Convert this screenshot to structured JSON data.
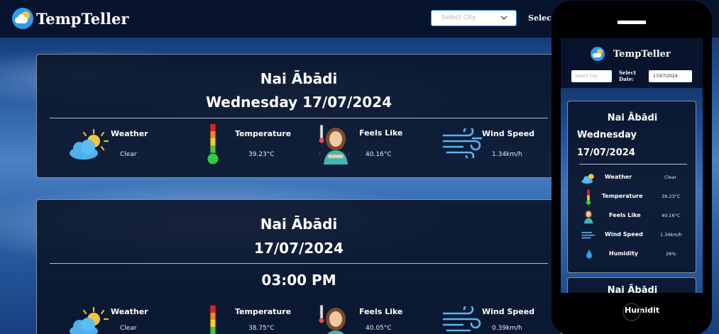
{
  "app": {
    "name": "TempTeller"
  },
  "navbar": {
    "select_city_placeholder": "Select City",
    "select_date_label": "Select Date:"
  },
  "current": {
    "city": "Nai Ābādi",
    "date_line": "Wednesday 17/07/2024",
    "metrics": [
      {
        "label": "Weather",
        "value": "Clear",
        "icon": "weather-sun-cloud-icon"
      },
      {
        "label": "Temperature",
        "value": "39.23°C",
        "icon": "thermometer-icon"
      },
      {
        "label": "Feels Like",
        "value": "40.16°C",
        "icon": "feels-like-person-icon"
      },
      {
        "label": "Wind Speed",
        "value": "1.34km/h",
        "icon": "wind-icon"
      }
    ]
  },
  "forecast": {
    "city": "Nai Ābādi",
    "date": "17/07/2024",
    "time": "03:00 PM",
    "metrics": [
      {
        "label": "Weather",
        "value": "Clear"
      },
      {
        "label": "Temperature",
        "value": "38.75°C"
      },
      {
        "label": "Feels Like",
        "value": "40.05°C"
      },
      {
        "label": "Wind Speed",
        "value": "0.39km/h"
      }
    ]
  },
  "mobile": {
    "app_name": "TempTeller",
    "select_city_placeholder": "Select City",
    "select_date_label": "Select Date:",
    "date_input_value": "17/07/2024",
    "card": {
      "city": "Nai Ābādi",
      "day": "Wednesday",
      "date": "17/07/2024",
      "rows": [
        {
          "label": "Weather",
          "value": "Clear"
        },
        {
          "label": "Temperature",
          "value": "39.23°C"
        },
        {
          "label": "Feels Like",
          "value": "40.16°C"
        },
        {
          "label": "Wind Speed",
          "value": "1.34km/h"
        },
        {
          "label": "Humidity",
          "value": "26%"
        }
      ]
    },
    "card2_title": "Nai Ābādi",
    "side_label": "Humidit"
  },
  "colors": {
    "navbar": "#08142e",
    "card_bg": "#0a142a",
    "accent": "#2d8cf0",
    "sun": "#f6b81e",
    "cloud": "#4db1ee"
  }
}
